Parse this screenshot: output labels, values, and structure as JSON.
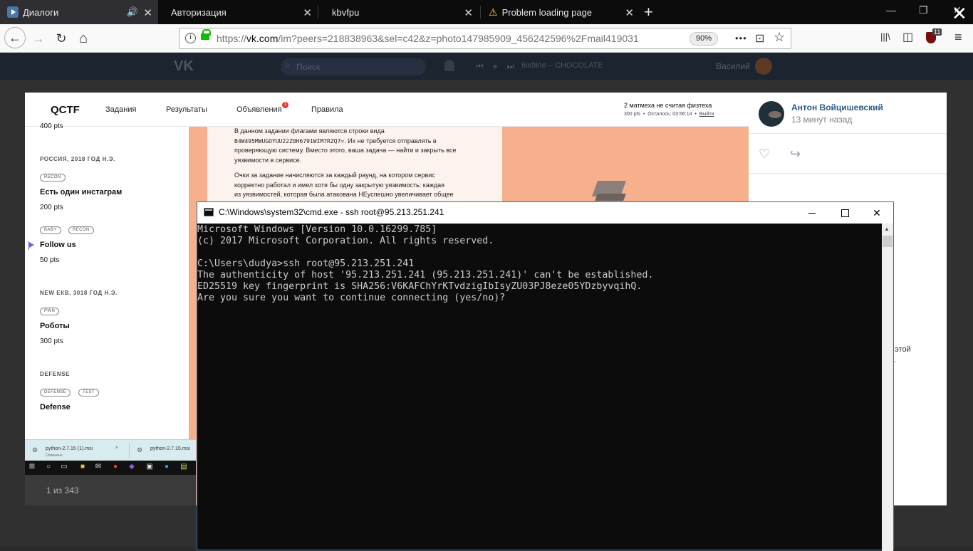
{
  "browser": {
    "tabs": [
      {
        "label": "Диалоги",
        "audio": "🔊",
        "close": "✕"
      },
      {
        "label": "Авторизация",
        "close": "✕"
      },
      {
        "label": "kbvfpu",
        "close": "✕"
      },
      {
        "label": "Problem loading page",
        "close": "✕",
        "warning": "⚠"
      }
    ],
    "new_tab": "+",
    "window_controls": {
      "minimize": "—",
      "restore": "❐",
      "close": "✕"
    },
    "nav": {
      "back": "←",
      "forward": "→",
      "reload": "↻",
      "home": "⌂"
    },
    "url": {
      "host": "vk.com",
      "prefix": "https://",
      "path": "/im?peers=218838963&sel=c42&z=photo147985909_456242596%2Fmail419031",
      "zoom": "90%"
    },
    "url_actions": {
      "more": "•••",
      "pocket": "⊡",
      "bookmark": "☆"
    },
    "toolbar": {
      "library": "|||\\",
      "sidebar": "◫",
      "addon_badge": "11",
      "menu": "≡"
    }
  },
  "vk": {
    "logo": "VK",
    "search_placeholder": "Поиск",
    "player_controls": "⏮ ⏸ ⏭",
    "track": "6ix9ine – CHOCOLATE",
    "user": "Василий",
    "close": "✕",
    "photo_counter": "1 из 343",
    "comment": {
      "author": "Антон Войцишевский",
      "time": "13 минут назад",
      "like_icon": "♡",
      "share_icon": "↪",
      "text_fragment_1": "ия этой",
      "text_fragment_2": "."
    }
  },
  "qctf": {
    "logo": "QCTF",
    "nav": [
      "Задания",
      "Результаты",
      "Объявления",
      "Правила"
    ],
    "announcements_badge": "1",
    "task_title": "2 матмеха не считая физтеха",
    "task_pts": "300 pts",
    "task_dot": "•",
    "task_time": "Осталось: 03:56:14",
    "logout": "Выйти",
    "sidebar": {
      "top_pts": "400 pts",
      "sections": [
        {
          "category": "РОССИЯ, 2018 ГОД Н.Э.",
          "tags": [
            "RECON"
          ],
          "task": "Есть один инстаграм",
          "pts": "200 pts"
        },
        {
          "category": "",
          "tags": [
            "BABY",
            "RECON"
          ],
          "task": "Follow us",
          "pts": "50 pts"
        },
        {
          "category": "NEW ЕКВ, 3018 ГОД Н.Э.",
          "tags": [
            "PWN"
          ],
          "task": "Роботы",
          "pts": "300 pts"
        },
        {
          "category": "DEFENSE",
          "tags": [
            "DEFENSE",
            "TEST"
          ],
          "task": "Defense",
          "pts": ""
        }
      ]
    },
    "description": {
      "p1_l1": "В данном задании флагами являются строки вида",
      "p1_flag": "B4W495MWUGOYUU22Z0H6791WIM7RZQ7=",
      "p1_l2_rest": ". Их не требуется отправлять в",
      "p1_l3": "проверяющую систему. Вместо этого, ваша задача — найти и закрыть все",
      "p1_l4": "уязвимости в сервисе.",
      "p2_l1": "Очки за задание начисляются за каждый раунд, на котором сервис",
      "p2_l2": "корректно работал и имел хотя бы одну закрытую уязвимость: каждая",
      "p2_l3": "из уязвимостей, которая была атакована НЕуспешно увеличивает общее"
    },
    "downloads": [
      {
        "file": "python-2.7.15 (1).msi",
        "status": "Отменено"
      },
      {
        "file": "python-2.7.15.msi"
      }
    ],
    "downloads_chevron": "^"
  },
  "cmd": {
    "title": "C:\\Windows\\system32\\cmd.exe - ssh  root@95.213.251.241",
    "controls": {
      "close": "✕"
    },
    "scroll_up": "▲",
    "lines": [
      "Microsoft Windows [Version 10.0.16299.785]",
      "(c) 2017 Microsoft Corporation. All rights reserved.",
      "",
      "C:\\Users\\dudya>ssh root@95.213.251.241",
      "The authenticity of host '95.213.251.241 (95.213.251.241)' can't be established.",
      "ED25519 key fingerprint is SHA256:V6KAFChYrKTvdzigIbIsyZU03PJ8eze05YDzbyvqihQ.",
      "Are you sure you want to continue connecting (yes/no)?"
    ]
  }
}
